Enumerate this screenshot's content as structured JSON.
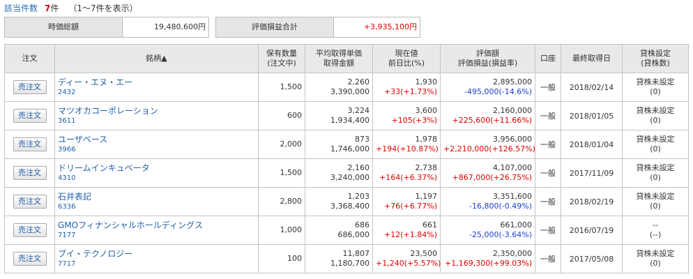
{
  "summary_count": {
    "label": "該当件数",
    "count": "7",
    "unit": "件",
    "range": "（1〜7件を表示）"
  },
  "totals": {
    "market_value_label": "時価総額",
    "market_value": "19,480,600円",
    "pl_label": "評価損益合計",
    "pl": "+3,935,100円"
  },
  "headers": {
    "order": "注文",
    "stock": "銘柄▲",
    "qty_1": "保有数量",
    "qty_2": "(注文中)",
    "avg_1": "平均取得単価",
    "avg_2": "取得金額",
    "price_1": "現在値",
    "price_2": "前日比(%)",
    "value_1": "評価額",
    "value_2": "評価損益(損益率)",
    "account": "口座",
    "last_date": "最終取得日",
    "lend_1": "貸株設定",
    "lend_2": "(貸株数)"
  },
  "colors": {
    "positive": "#e00000",
    "negative": "#1b3fd1",
    "link": "#1f5ea8"
  },
  "rows": [
    {
      "btn": "売注文",
      "name": "ディー・エヌ・エー",
      "code": "2432",
      "qty": "1,500",
      "avg": "2,260",
      "cost": "3,390,000",
      "price": "1,930",
      "change": "+33(+1.73%)",
      "change_sign": "pos",
      "value": "2,895,000",
      "pl": "-495,000(-14.6%)",
      "pl_sign": "neg",
      "account": "一般",
      "date": "2018/02/14",
      "lend": "貸株未設定",
      "lend_qty": "(0)"
    },
    {
      "btn": "売注文",
      "name": "マツオカコーポレーション",
      "code": "3611",
      "qty": "600",
      "avg": "3,224",
      "cost": "1,934,400",
      "price": "3,600",
      "change": "+105(+3%)",
      "change_sign": "pos",
      "value": "2,160,000",
      "pl": "+225,600(+11.66%)",
      "pl_sign": "pos",
      "account": "一般",
      "date": "2018/01/05",
      "lend": "貸株未設定",
      "lend_qty": "(0)"
    },
    {
      "btn": "売注文",
      "name": "ユーザベース",
      "code": "3966",
      "qty": "2,000",
      "avg": "873",
      "cost": "1,746,000",
      "price": "1,978",
      "change": "+194(+10.87%)",
      "change_sign": "pos",
      "value": "3,956,000",
      "pl": "+2,210,000(+126.57%)",
      "pl_sign": "pos",
      "account": "一般",
      "date": "2018/01/04",
      "lend": "貸株未設定",
      "lend_qty": "(0)"
    },
    {
      "btn": "売注文",
      "name": "ドリームインキュベータ",
      "code": "4310",
      "qty": "1,500",
      "avg": "2,160",
      "cost": "3,240,000",
      "price": "2,738",
      "change": "+164(+6.37%)",
      "change_sign": "pos",
      "value": "4,107,000",
      "pl": "+867,000(+26.75%)",
      "pl_sign": "pos",
      "account": "一般",
      "date": "2017/11/09",
      "lend": "貸株未設定",
      "lend_qty": "(0)"
    },
    {
      "btn": "売注文",
      "name": "石井表記",
      "code": "6336",
      "qty": "2,800",
      "avg": "1,203",
      "cost": "3,368,400",
      "price": "1,197",
      "change": "+76(+6.77%)",
      "change_sign": "pos",
      "value": "3,351,600",
      "pl": "-16,800(-0.49%)",
      "pl_sign": "neg",
      "account": "一般",
      "date": "2018/02/19",
      "lend": "貸株未設定",
      "lend_qty": "(0)"
    },
    {
      "btn": "売注文",
      "name": "GMOフィナンシャルホールディングス",
      "code": "7177",
      "qty": "1,000",
      "avg": "686",
      "cost": "686,000",
      "price": "661",
      "change": "+12(+1.84%)",
      "change_sign": "pos",
      "value": "661,000",
      "pl": "-25,000(-3.64%)",
      "pl_sign": "neg",
      "account": "一般",
      "date": "2016/07/19",
      "lend": "--",
      "lend_qty": "(--)"
    },
    {
      "btn": "売注文",
      "name": "ブイ・テクノロジー",
      "code": "7717",
      "qty": "100",
      "avg": "11,807",
      "cost": "1,180,700",
      "price": "23,500",
      "change": "+1,240(+5.57%)",
      "change_sign": "pos",
      "value": "2,350,000",
      "pl": "+1,169,300(+99.03%)",
      "pl_sign": "pos",
      "account": "一般",
      "date": "2017/05/08",
      "lend": "貸株未設定",
      "lend_qty": "(0)"
    }
  ]
}
